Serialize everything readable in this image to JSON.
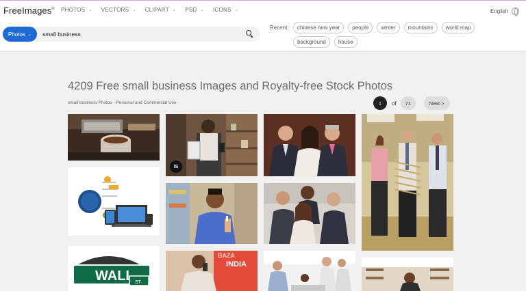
{
  "header": {
    "logo": "FreeImages",
    "logo_mark": "®",
    "nav": [
      {
        "label": "PHOTOS"
      },
      {
        "label": "VECTORS"
      },
      {
        "label": "CLIPART"
      },
      {
        "label": "PSD"
      },
      {
        "label": "ICONS"
      }
    ],
    "language": "English",
    "icons": {
      "chevron": "chevron-down-icon",
      "globe": "globe-icon",
      "search": "search-icon"
    }
  },
  "search": {
    "type_label": "Photos",
    "query": "small business"
  },
  "recent": {
    "label": "Recent:",
    "tags": [
      "chinese new year",
      "people",
      "winter",
      "mountains",
      "world map",
      "background",
      "house"
    ]
  },
  "results": {
    "title": "4209 Free small business Images and Royalty-free Stock Photos",
    "subtitle": "small business Photos - Personal and Commercial Use",
    "pagination": {
      "current": "1",
      "of": "of",
      "total": "71",
      "next": "Next >"
    },
    "badge": "iS"
  },
  "colors": {
    "accent": "#1f6bd6",
    "header_bg": "#ffffff",
    "page_bg": "#f1f1f1"
  }
}
